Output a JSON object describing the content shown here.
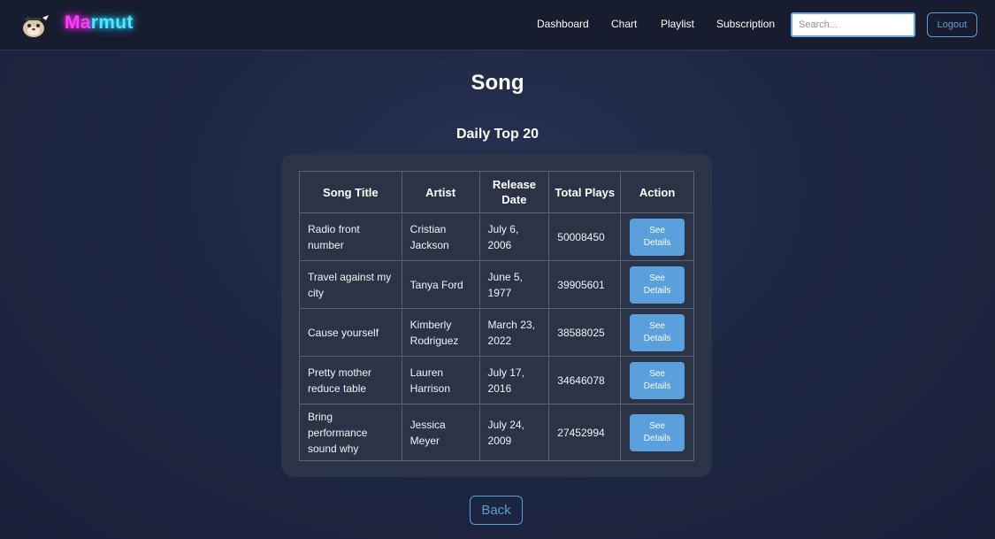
{
  "navbar": {
    "brand_part1": "Ma",
    "brand_part2": "rmut",
    "logo_icon": "marmot-logo-icon",
    "links": [
      "Dashboard",
      "Chart",
      "Playlist",
      "Subscription"
    ],
    "search_placeholder": "Search...",
    "logout_label": "Logout"
  },
  "page": {
    "title": "Song",
    "section_title": "Daily Top 20",
    "back_label": "Back"
  },
  "table": {
    "headers": [
      "Song Title",
      "Artist",
      "Release Date",
      "Total Plays",
      "Action"
    ],
    "rows": [
      {
        "title": "Radio front number",
        "artist": "Cristian Jackson",
        "release_date": "July 6, 2006",
        "plays": "50008450",
        "action": "See Details"
      },
      {
        "title": "Travel against my city",
        "artist": "Tanya Ford",
        "release_date": "June 5, 1977",
        "plays": "39905601",
        "action": "See Details"
      },
      {
        "title": "Cause yourself",
        "artist": "Kimberly Rodriguez",
        "release_date": "March 23, 2022",
        "plays": "38588025",
        "action": "See Details"
      },
      {
        "title": "Pretty mother reduce table",
        "artist": "Lauren Harrison",
        "release_date": "July 17, 2016",
        "plays": "34646078",
        "action": "See Details"
      },
      {
        "title": "Bring performance sound why",
        "artist": "Jessica Meyer",
        "release_date": "July 24, 2009",
        "plays": "27452994",
        "action": "See Details"
      }
    ]
  },
  "colors": {
    "accent": "#5aa0dc",
    "navbar_bg": "#171c2e",
    "card_bg": "#2b3346",
    "brand_pink": "#ff3df5",
    "brand_cyan": "#4fe8ff"
  }
}
